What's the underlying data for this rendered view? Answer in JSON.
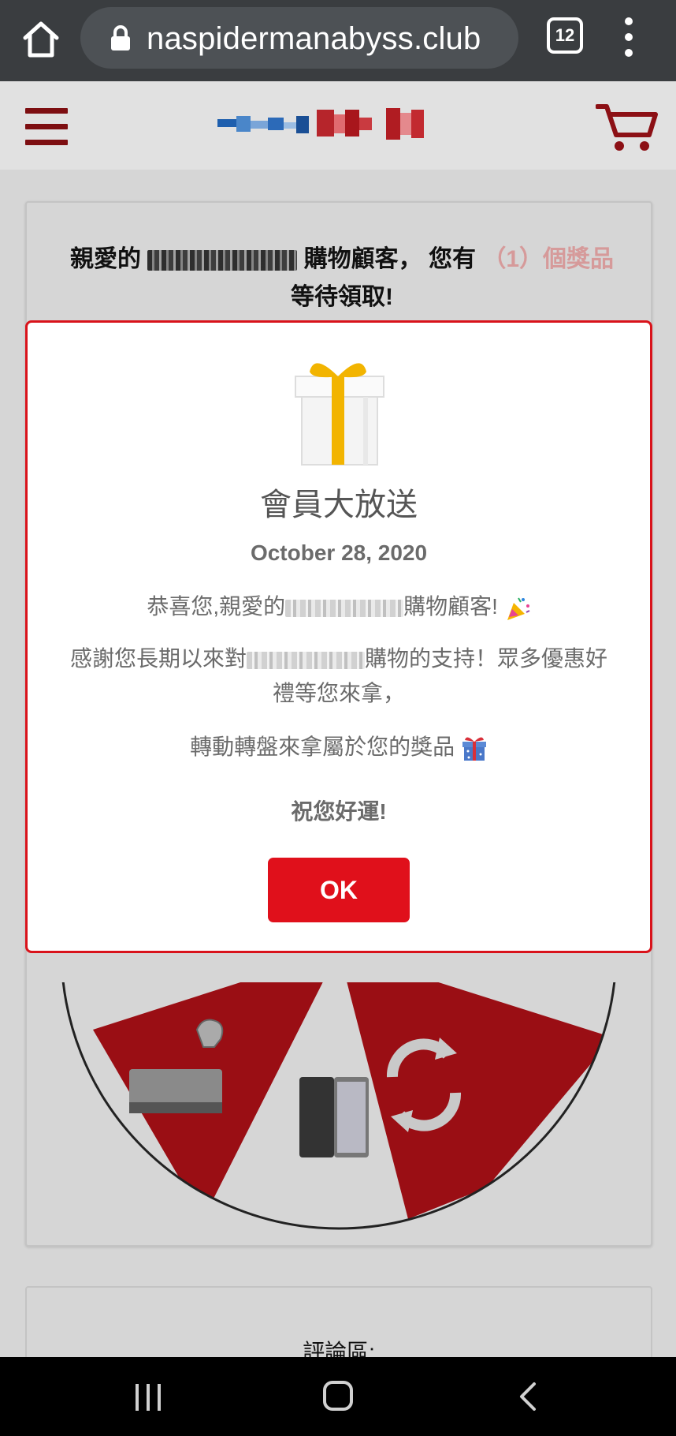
{
  "browser": {
    "url": "naspidermanabyss.club",
    "tab_count": "12"
  },
  "site": {
    "brand_color": "#7d0e11"
  },
  "card": {
    "message_prefix": "親愛的",
    "message_mid": "購物顧客， 您有",
    "message_highlight": "（1）個獎品",
    "message_suffix": "等待領取!"
  },
  "modal": {
    "title": "會員大放送",
    "date": "October 28, 2020",
    "line1_prefix": "恭喜您,親愛的",
    "line1_suffix": "購物顧客!",
    "line2_prefix": "感謝您長期以來對",
    "line2_suffix": "購物的支持！眾多優惠好禮等您來拿，",
    "line3": "轉動轉盤來拿屬於您的獎品",
    "luck": "祝您好運!",
    "ok_label": "OK",
    "border_color": "#d9131b"
  },
  "comments": {
    "title": "評論區:"
  },
  "icons": [
    "home-icon",
    "lock-icon",
    "tab-switcher-icon",
    "more-vert-icon",
    "hamburger-menu-icon",
    "cart-icon",
    "gift-box-icon",
    "party-popper-icon",
    "gift-icon",
    "recents-icon",
    "nav-home-icon",
    "back-icon"
  ]
}
